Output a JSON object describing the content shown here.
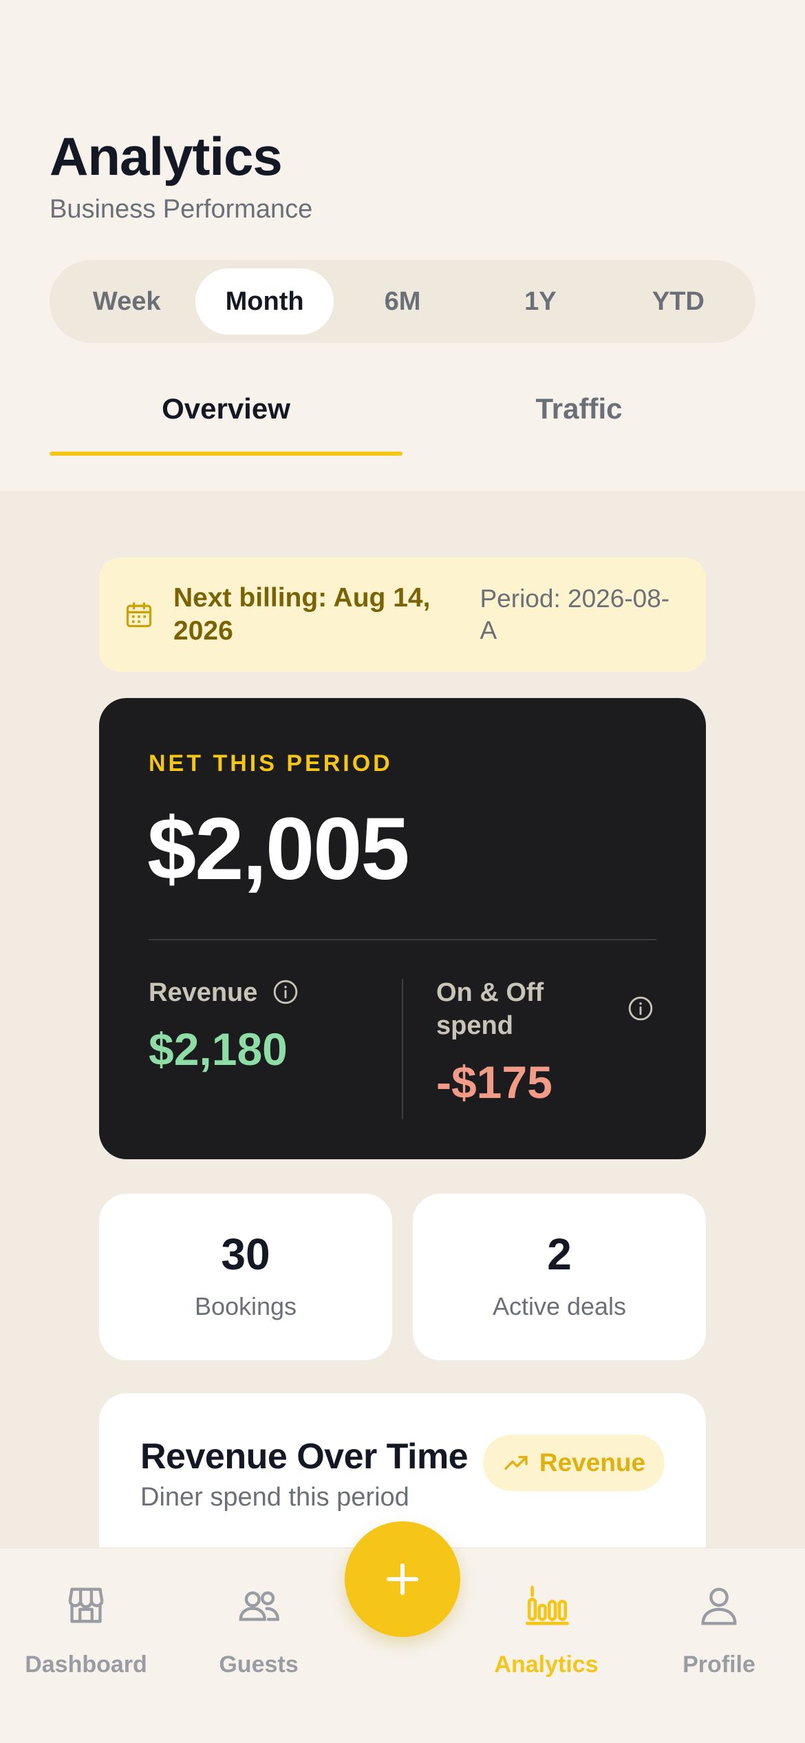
{
  "header": {
    "title": "Analytics",
    "subtitle": "Business Performance"
  },
  "range_selector": {
    "options": [
      "Week",
      "Month",
      "6M",
      "1Y",
      "YTD"
    ],
    "selected": "Month"
  },
  "tabs": [
    {
      "label": "Overview",
      "active": true
    },
    {
      "label": "Traffic",
      "active": false
    }
  ],
  "billing": {
    "icon": "calendar-icon",
    "next_billing": "Next billing: Aug 14, 2026",
    "period": "Period: 2026-08-A"
  },
  "net_card": {
    "label": "NET THIS PERIOD",
    "value": "$2,005",
    "revenue_label": "Revenue",
    "revenue_value": "$2,180",
    "spend_label": "On & Off spend",
    "spend_value": "-$175"
  },
  "stats": [
    {
      "value": "30",
      "label": "Bookings"
    },
    {
      "value": "2",
      "label": "Active deals"
    }
  ],
  "revenue_card": {
    "title": "Revenue Over Time",
    "subtitle": "Diner spend this period",
    "pill_label": "Revenue"
  },
  "bottom_nav": {
    "items": [
      {
        "label": "Dashboard",
        "icon": "store-icon",
        "active": false
      },
      {
        "label": "Guests",
        "icon": "users-icon",
        "active": false
      },
      {
        "label": "Analytics",
        "icon": "bar-chart-icon",
        "active": true
      },
      {
        "label": "Profile",
        "icon": "person-icon",
        "active": false
      }
    ],
    "fab_icon": "plus-icon"
  },
  "colors": {
    "accent": "#F5C518",
    "positive": "#8EDDA6",
    "negative": "#F29B86",
    "card_dark": "#1C1C1E"
  }
}
